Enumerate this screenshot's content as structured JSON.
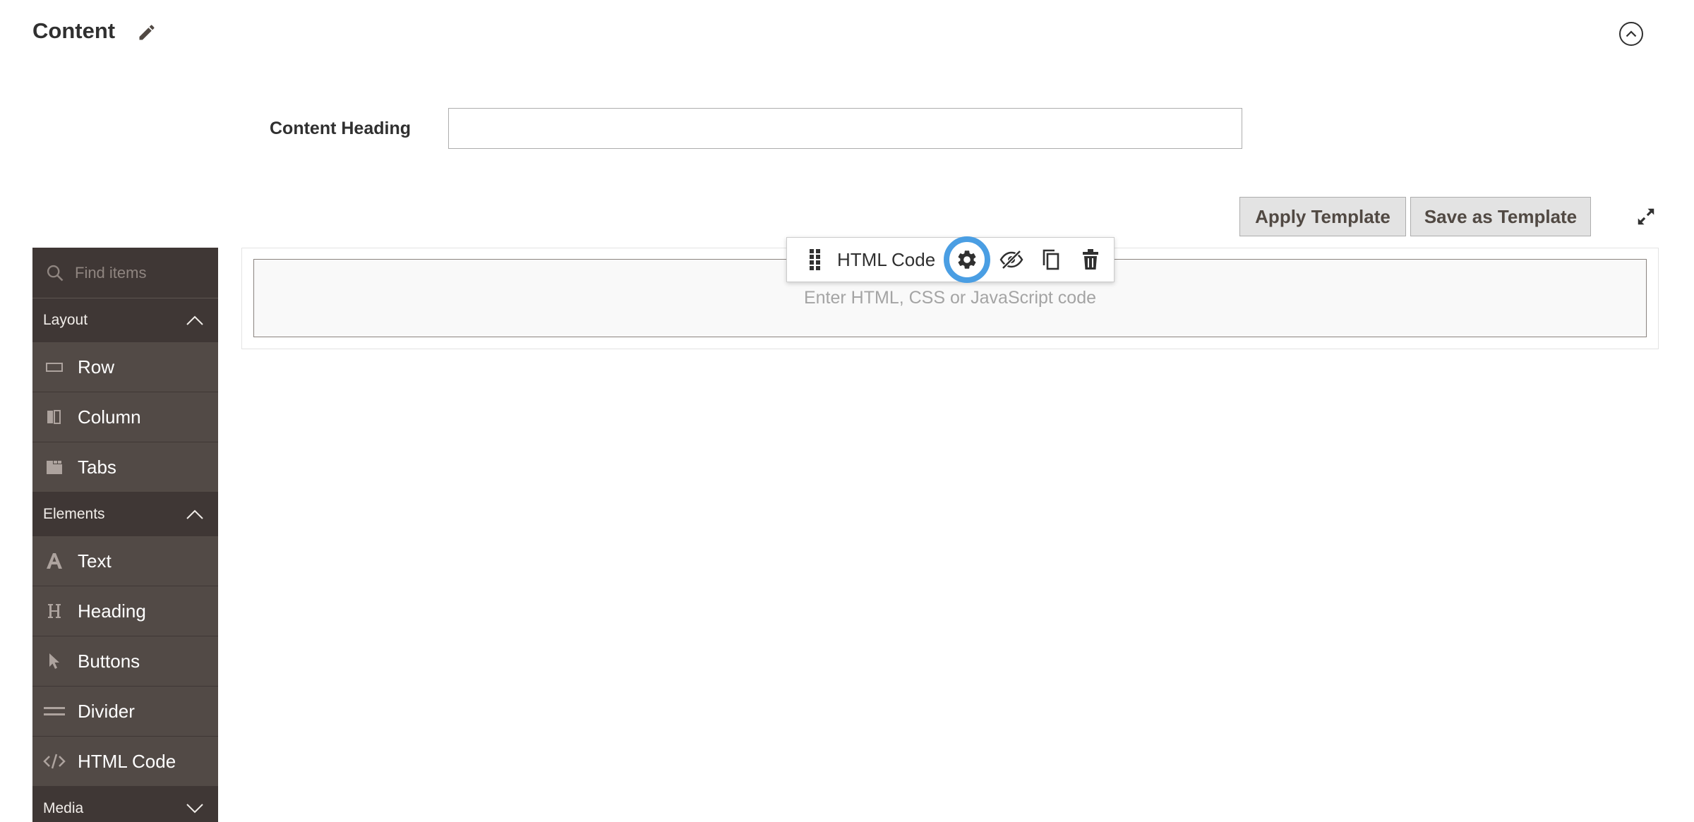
{
  "header": {
    "title": "Content"
  },
  "form": {
    "heading_label": "Content Heading",
    "heading_value": ""
  },
  "templates": {
    "apply_label": "Apply Template",
    "save_label": "Save as Template"
  },
  "sidebar": {
    "search_placeholder": "Find items",
    "groups": [
      {
        "label": "Layout",
        "expanded": true,
        "items": [
          {
            "label": "Row",
            "icon": "row-icon"
          },
          {
            "label": "Column",
            "icon": "column-icon"
          },
          {
            "label": "Tabs",
            "icon": "tabs-icon"
          }
        ]
      },
      {
        "label": "Elements",
        "expanded": true,
        "items": [
          {
            "label": "Text",
            "icon": "text-icon"
          },
          {
            "label": "Heading",
            "icon": "heading-icon"
          },
          {
            "label": "Buttons",
            "icon": "cursor-icon"
          },
          {
            "label": "Divider",
            "icon": "divider-icon"
          },
          {
            "label": "HTML Code",
            "icon": "code-icon"
          }
        ]
      },
      {
        "label": "Media",
        "expanded": false,
        "items": []
      }
    ]
  },
  "stage": {
    "placeholder": "Enter HTML, CSS or JavaScript code",
    "toolbar": {
      "title": "HTML Code",
      "icons": [
        "drag-handle-icon",
        "gear-icon",
        "hide-icon",
        "duplicate-icon",
        "trash-icon"
      ]
    }
  },
  "colors": {
    "sidebar_bg": "#524a46",
    "sidebar_header_bg": "#3f3735",
    "focus_ring": "#4a9ee3",
    "button_bg": "#e3e3e3"
  }
}
